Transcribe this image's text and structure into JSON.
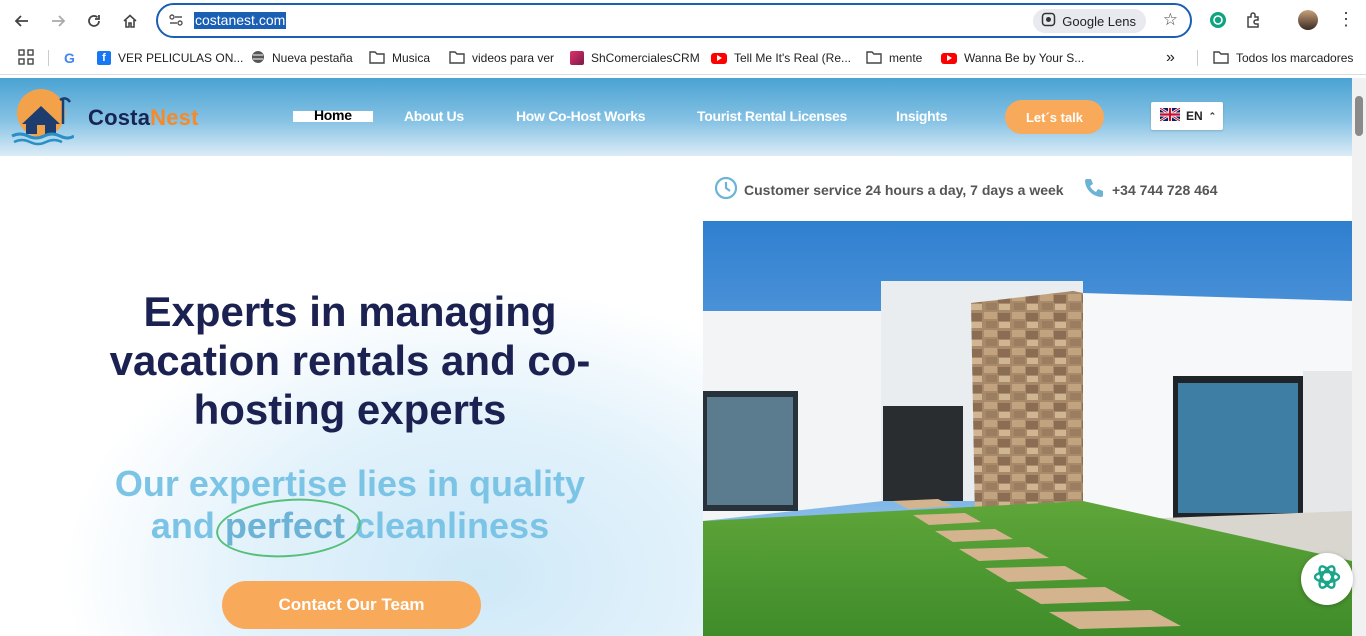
{
  "browser": {
    "url": "costanest.com",
    "lens_label": "Google Lens",
    "bookmarks": [
      {
        "label": "",
        "icon": "google-icon"
      },
      {
        "label": "VER PELICULAS ON...",
        "icon": "facebook-icon"
      },
      {
        "label": "Nueva pestaña",
        "icon": "globe-icon"
      },
      {
        "label": "Musica",
        "icon": "folder-icon"
      },
      {
        "label": "videos para ver",
        "icon": "folder-icon"
      },
      {
        "label": "ShComercialesCRM",
        "icon": "app-icon"
      },
      {
        "label": "Tell Me It's Real (Re...",
        "icon": "youtube-icon"
      },
      {
        "label": "mente",
        "icon": "folder-icon"
      },
      {
        "label": "Wanna Be by Your S...",
        "icon": "youtube-icon"
      }
    ],
    "overflow_label": "»",
    "all_bookmarks": "Todos los marcadores"
  },
  "site": {
    "brand_part1": "Costa",
    "brand_part2": "Nest",
    "nav": {
      "home": "Home",
      "about": "About Us",
      "cohost": "How Co-Host Works",
      "licenses": "Tourist Rental Licenses",
      "insights": "Insights"
    },
    "cta_talk": "Let´s talk",
    "language": "EN",
    "service_text": "Customer service 24 hours a day, 7 days a week",
    "phone": "+34 744 728 464",
    "headline": "Experts in managing vacation rentals and co-hosting experts",
    "sub_line1": "Our expertise lies in quality",
    "sub_and": "and",
    "sub_perfect": "perfect",
    "sub_end": "cleanliness",
    "contact_button": "Contact Our Team"
  },
  "colors": {
    "navy": "#1b2150",
    "orange": "#f8a95a",
    "sky": "#7cc4e6",
    "accent_green": "#55c07a",
    "browser_blue": "#1a5fb4"
  }
}
